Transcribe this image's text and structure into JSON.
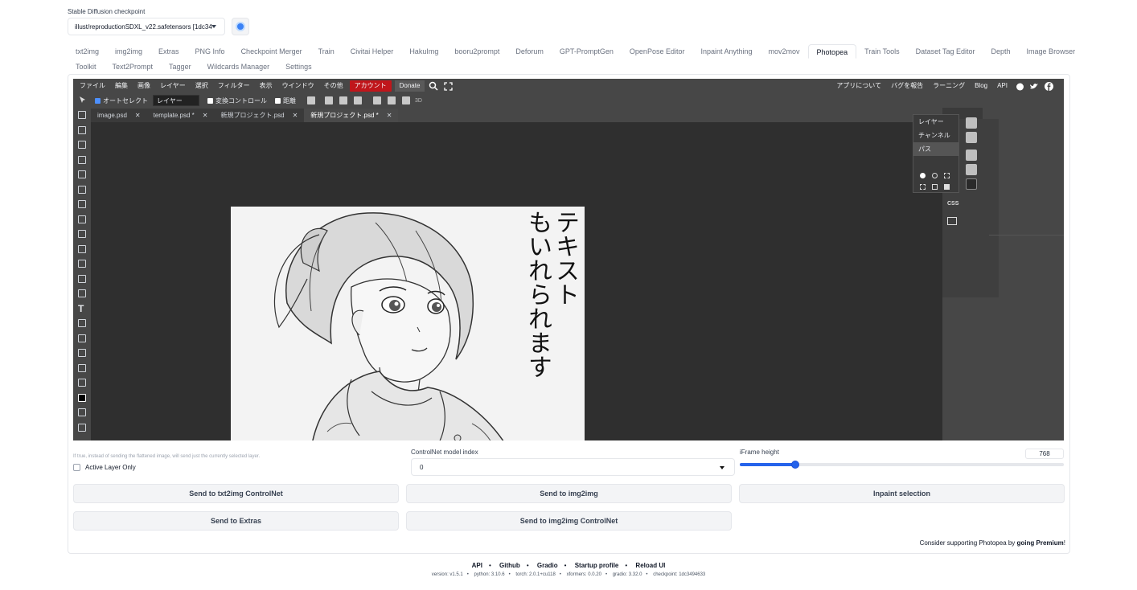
{
  "checkpoint": {
    "label": "Stable Diffusion checkpoint",
    "value": "illust/reproductionSDXL_v22.safetensors [1dc34"
  },
  "tabs_row1": [
    "txt2img",
    "img2img",
    "Extras",
    "PNG Info",
    "Checkpoint Merger",
    "Train",
    "Civitai Helper",
    "HakuImg",
    "booru2prompt",
    "Deforum",
    "GPT-PromptGen",
    "OpenPose Editor",
    "Inpaint Anything",
    "mov2mov",
    "Photopea",
    "Train Tools",
    "Dataset Tag Editor",
    "Depth",
    "Image Browser"
  ],
  "tabs_row2": [
    "Toolkit",
    "Text2Prompt",
    "Tagger",
    "Wildcards Manager",
    "Settings"
  ],
  "active_tab": "Photopea",
  "photopea": {
    "menus": [
      "ファイル",
      "編集",
      "画像",
      "レイヤー",
      "選択",
      "フィルター",
      "表示",
      "ウインドウ",
      "その他"
    ],
    "account": "アカウント",
    "donate": "Donate",
    "right_menus": [
      "アプリについて",
      "バグを報告",
      "ラーニング",
      "Blog",
      "API"
    ],
    "options": {
      "autoselect": "オートセレクト",
      "layer_select": "レイヤー",
      "transform": "変換コントロール",
      "distance": "距離",
      "three_d": "3D"
    },
    "doc_tabs": [
      "image.psd",
      "template.psd *",
      "新規プロジェクト.psd",
      "新規プロジェクト.psd *"
    ],
    "panel_items": [
      "レイヤー",
      "チャンネル",
      "パス"
    ],
    "css_label": "CSS",
    "canvas_text_col1": "テキスト",
    "canvas_text_col2": "もいれられます"
  },
  "controls": {
    "hint": "If true, instead of sending the flattened image, will send just the currently selected layer.",
    "active_layer_only": "Active Layer Only",
    "controlnet_label": "ControlNet model index",
    "controlnet_value": "0",
    "iframe_label": "iFrame height",
    "iframe_value": "768",
    "iframe_level": 0.17
  },
  "buttons": {
    "send_txt2img_cn": "Send to txt2img ControlNet",
    "send_img2img": "Send to img2img",
    "inpaint_selection": "Inpaint selection",
    "send_extras": "Send to Extras",
    "send_img2img_cn": "Send to img2img ControlNet"
  },
  "support": {
    "text": "Consider supporting Photopea by ",
    "link": "going Premium",
    "end": "!"
  },
  "footer": {
    "links": [
      "API",
      "Github",
      "Gradio",
      "Startup profile",
      "Reload UI"
    ],
    "version_items": [
      "version: v1.5.1",
      "python: 3.10.6",
      "torch: 2.0.1+cu118",
      "xformers: 0.0.20",
      "gradio: 3.32.0",
      "checkpoint: 1dc3494633"
    ]
  }
}
